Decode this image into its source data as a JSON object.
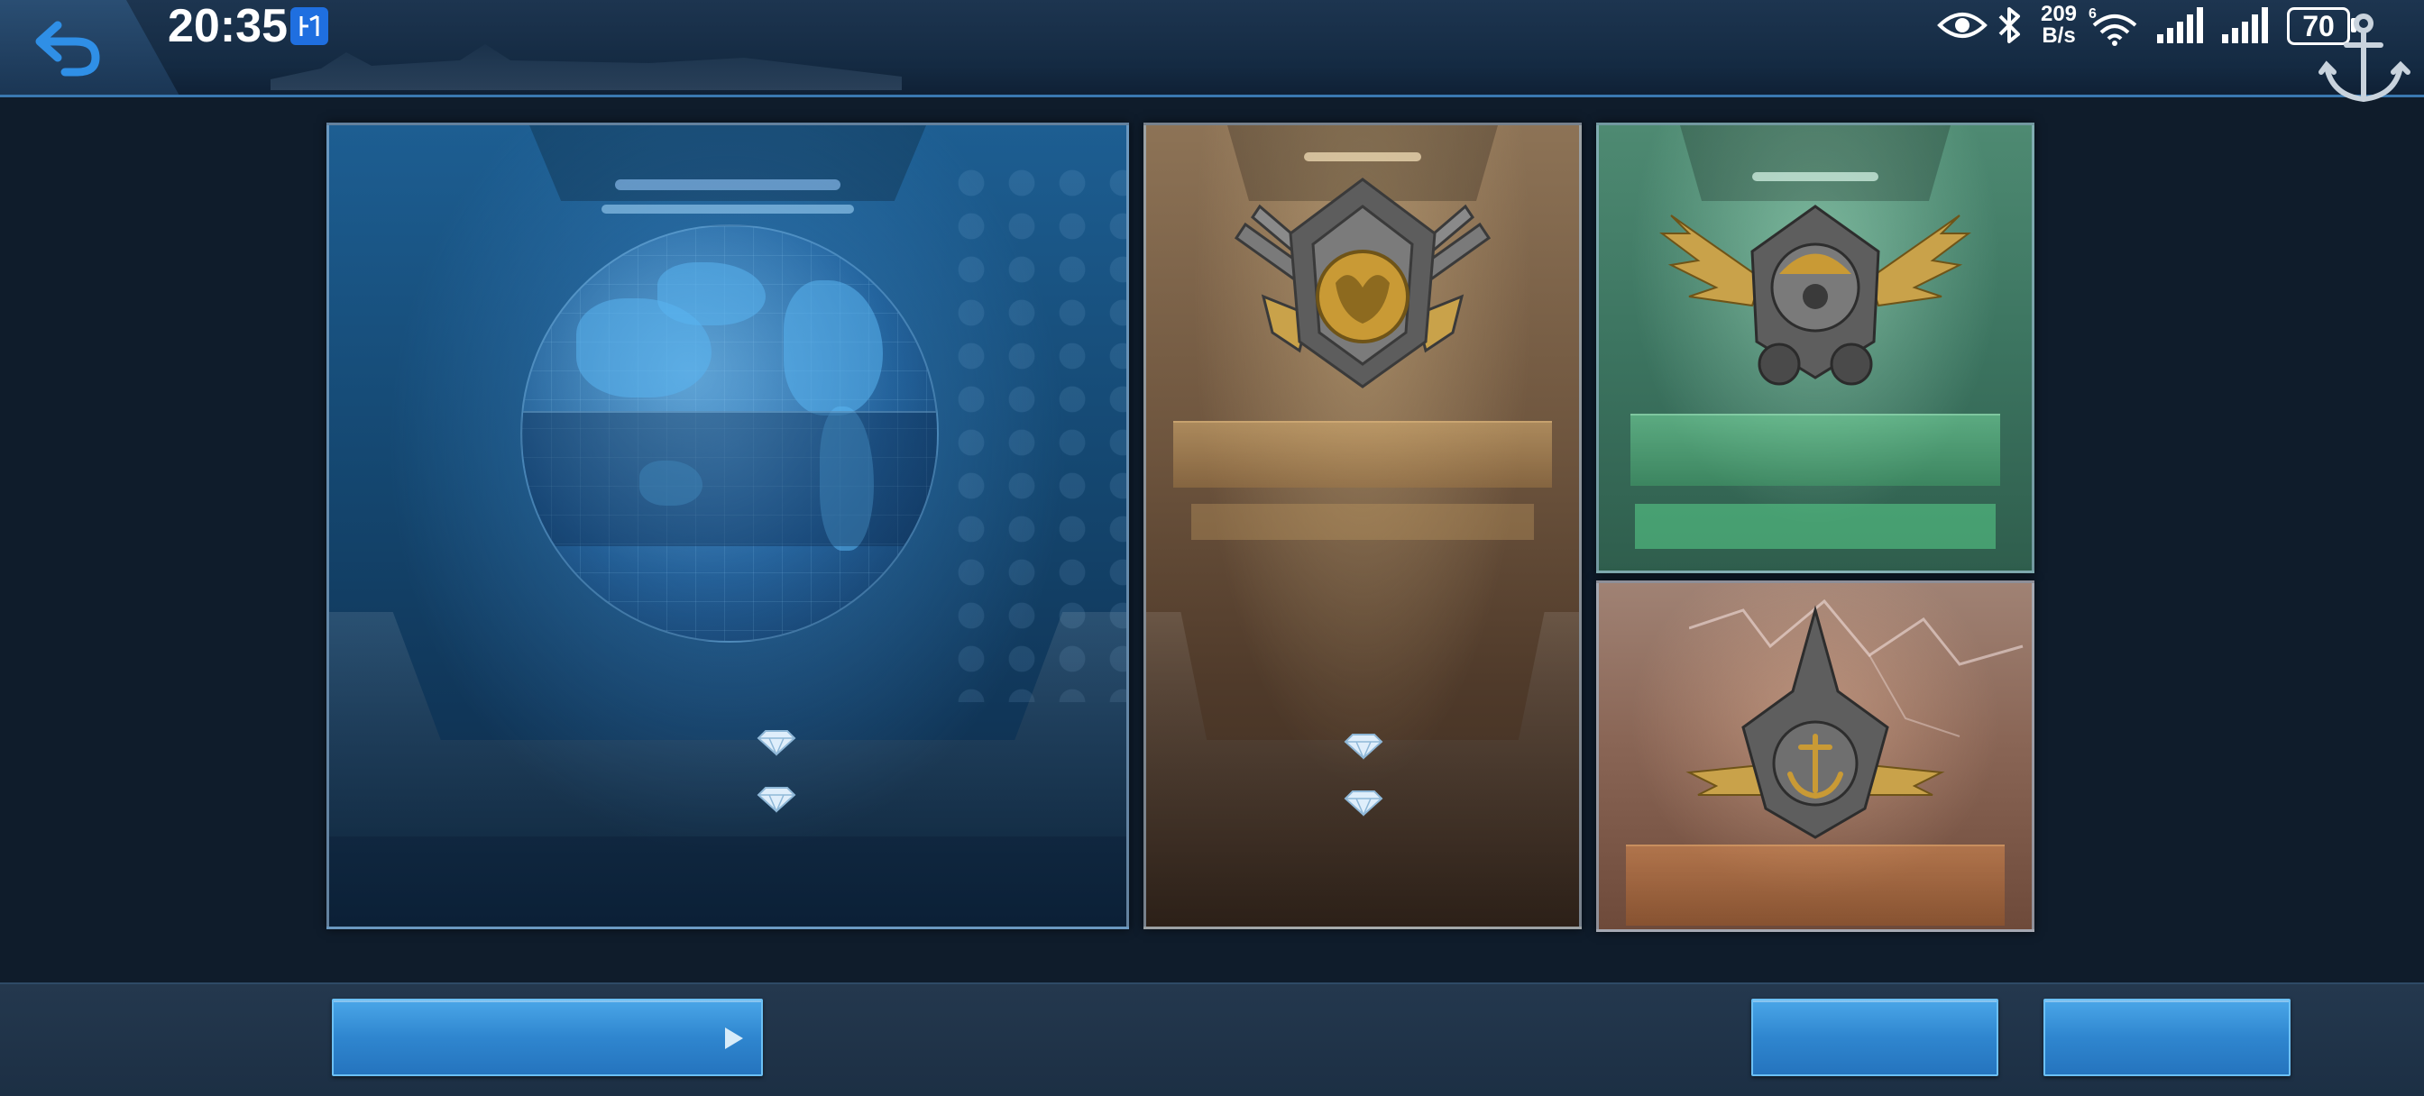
{
  "status_bar": {
    "time": "20:35",
    "net_speed_value": "209",
    "net_speed_unit": "B/s",
    "battery": "70",
    "icons": [
      "hex-app-icon",
      "eye-icon",
      "bluetooth-icon",
      "wifi-6-icon",
      "signal-icon",
      "signal-icon",
      "battery-icon"
    ]
  },
  "top_bar": {
    "back_icon": "back-arrow-icon",
    "emblem_icon": "anchor-emblem-icon"
  },
  "cards": [
    {
      "id": "world-map",
      "theme": "blue",
      "emblem": "globe-icon",
      "gem_icons": 2
    },
    {
      "id": "lion-badge",
      "theme": "brown",
      "emblem": "lion-shield-emblem-icon",
      "gem_icons": 2
    },
    {
      "id": "winged-gear",
      "theme": "green",
      "emblem": "winged-gear-emblem-icon"
    },
    {
      "id": "anchor-badge",
      "theme": "copper",
      "emblem": "anchor-winged-emblem-icon"
    }
  ],
  "bottom_bar": {
    "left_button_icon": "play-arrow-icon",
    "buttons": [
      "left-wide-button",
      "right-button-1",
      "right-button-2"
    ]
  },
  "colors": {
    "background": "#0f1c2b",
    "accent_blue": "#2f86cf",
    "topbar_edge": "#3a78b0"
  }
}
